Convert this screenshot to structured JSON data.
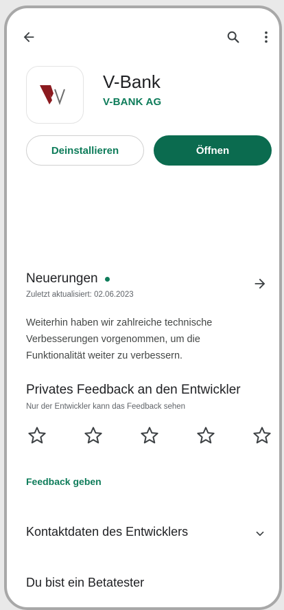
{
  "header": {
    "back_icon": "arrow-back-icon",
    "search_icon": "search-icon",
    "more_icon": "more-vert-icon"
  },
  "app": {
    "name": "V-Bank",
    "developer": "V-BANK AG",
    "icon": "v-bank-logo",
    "logo_color": "#8b1a1f"
  },
  "actions": {
    "uninstall_label": "Deinstallieren",
    "open_label": "Öffnen"
  },
  "whats_new": {
    "title": "Neuerungen",
    "updated": "Zuletzt aktualisiert: 02.06.2023",
    "notes": "Weiterhin haben wir zahlreiche technische Verbesserungen vorgenommen, um die Funktionalität weiter zu verbessern."
  },
  "feedback": {
    "title": "Privates Feedback an den Entwickler",
    "subtitle": "Nur der Entwickler kann das Feedback sehen",
    "star_rating": 0,
    "star_count": 5,
    "link": "Feedback geben"
  },
  "contact": {
    "label": "Kontaktdaten des Entwicklers"
  },
  "beta": {
    "label": "Du bist ein Betatester"
  },
  "colors": {
    "accent": "#0e7c5a",
    "button": "#0b6b4f"
  }
}
